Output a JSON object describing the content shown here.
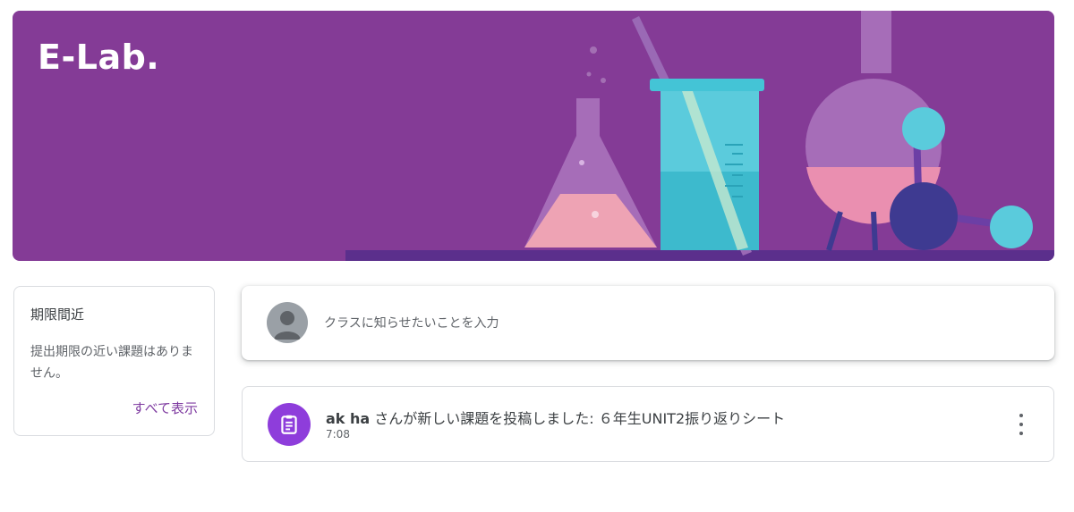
{
  "banner": {
    "title": "E-Lab.",
    "color": "#843b96"
  },
  "upcoming": {
    "title": "期限間近",
    "message": "提出期限の近い課題はありません。",
    "view_all": "すべて表示"
  },
  "compose": {
    "placeholder": "クラスに知らせたいことを入力",
    "avatar_icon": "person-avatar-icon"
  },
  "stream": {
    "posts": [
      {
        "author": "ak ha",
        "text": " さんが新しい課題を投稿しました: ６年生UNIT2振り返りシート",
        "time": "7:08",
        "icon": "assignment-icon",
        "icon_color": "#8e3ddb"
      }
    ]
  }
}
